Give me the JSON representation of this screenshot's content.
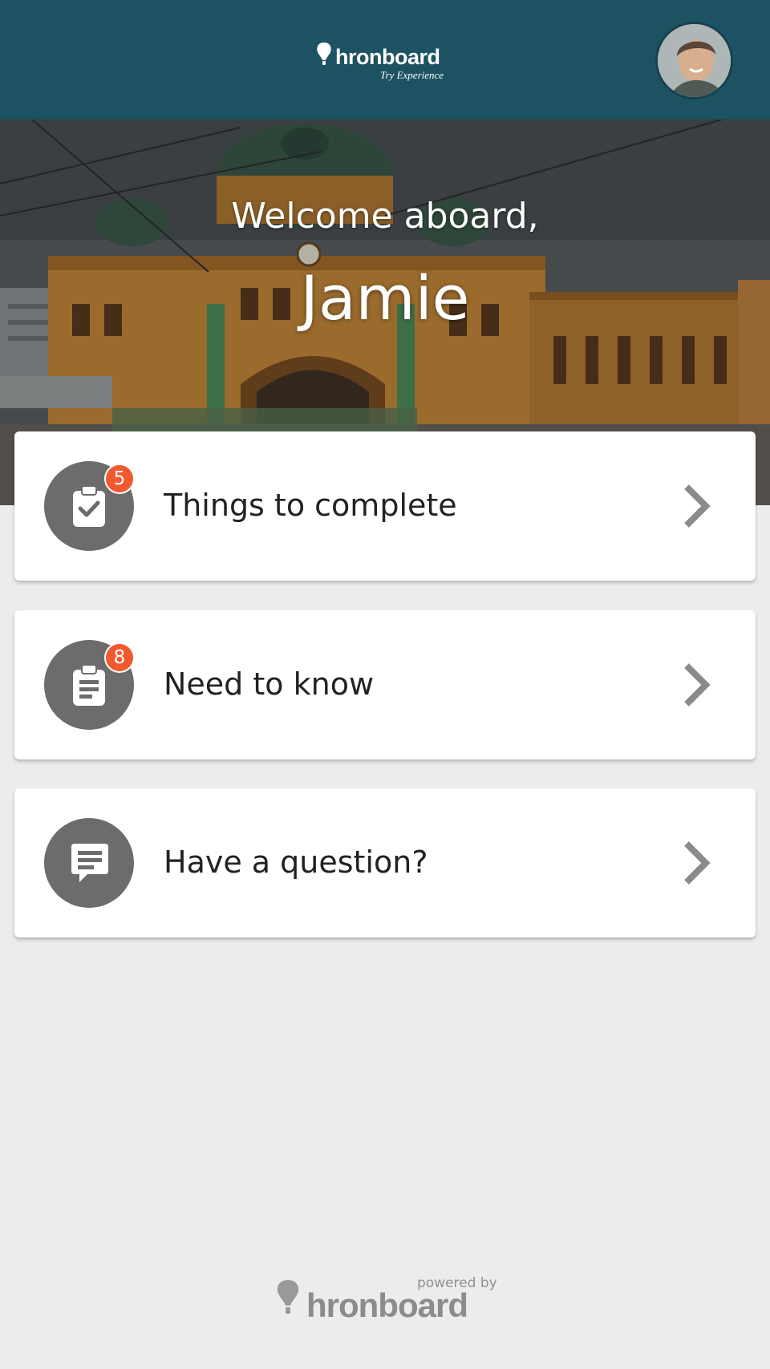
{
  "header": {
    "brand_name": "hronboard",
    "brand_tagline": "Try Experience"
  },
  "hero": {
    "greeting": "Welcome aboard,",
    "user_name": "Jamie"
  },
  "cards": [
    {
      "label": "Things to complete",
      "badge": "5",
      "icon": "clipboard-check-icon"
    },
    {
      "label": "Need to know",
      "badge": "8",
      "icon": "clipboard-list-icon"
    },
    {
      "label": "Have a question?",
      "badge": null,
      "icon": "chat-bubble-icon"
    }
  ],
  "footer": {
    "powered_by": "powered by",
    "brand_name": "hronboard"
  },
  "colors": {
    "header_bg": "#1c5261",
    "badge": "#f15a2f",
    "icon_circle": "#6c6c6c",
    "page_bg": "#ececec"
  }
}
